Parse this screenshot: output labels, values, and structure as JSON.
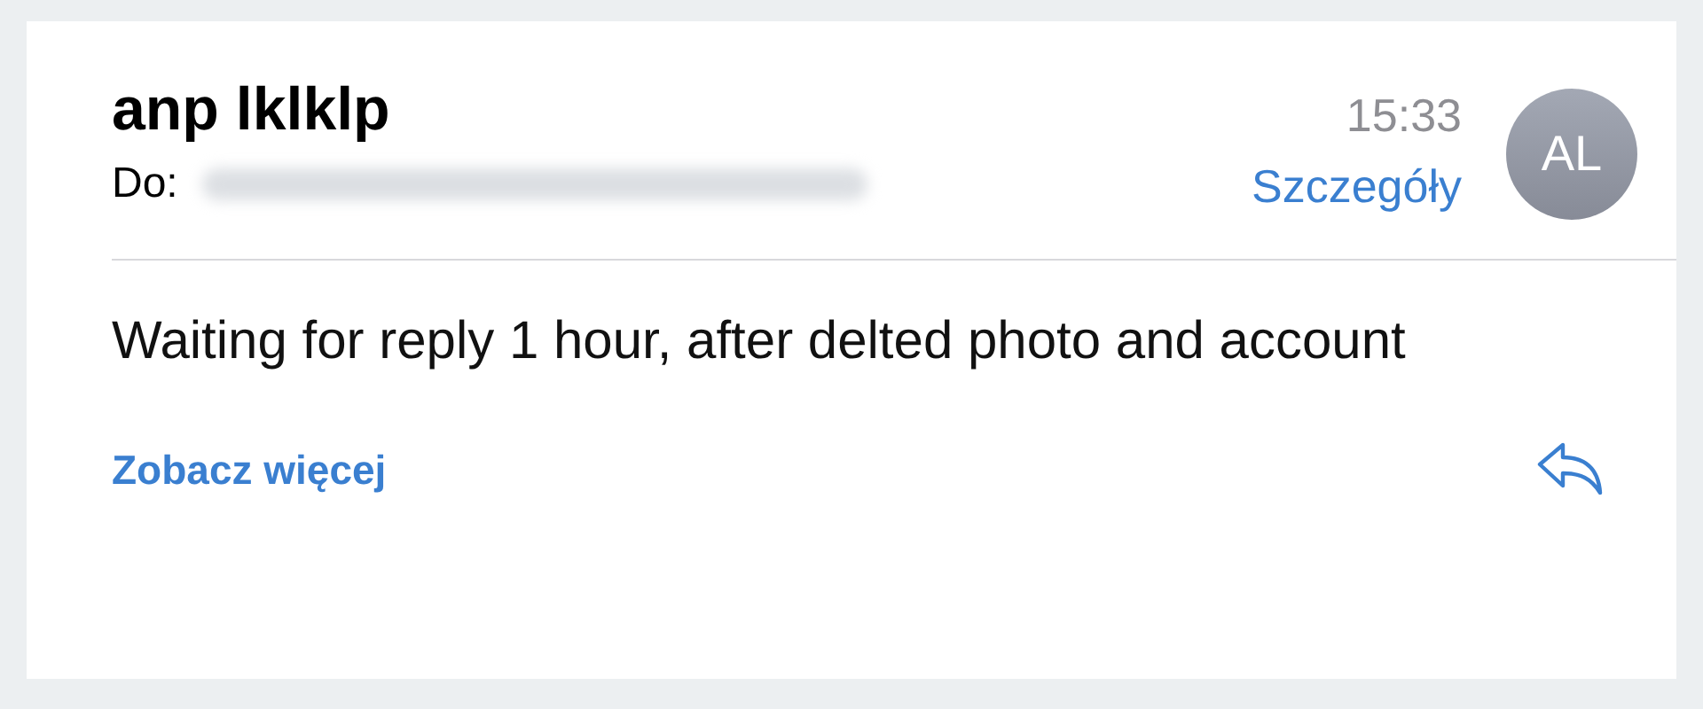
{
  "message": {
    "sender": "anp lklklp",
    "to_label": "Do:",
    "time": "15:33",
    "details_link": "Szczegóły",
    "avatar_initials": "AL",
    "body": "Waiting for reply 1 hour, after delted photo and account",
    "more_link": "Zobacz więcej"
  }
}
